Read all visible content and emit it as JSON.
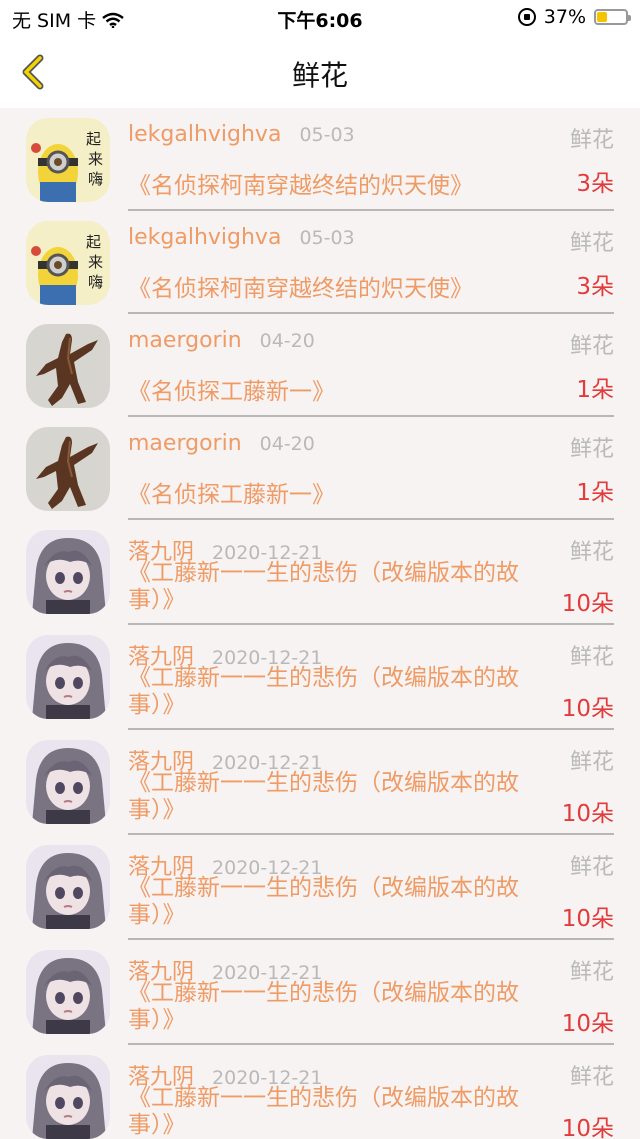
{
  "status_bar": {
    "carrier": "无 SIM 卡",
    "time": "下午6:06",
    "battery": "37%",
    "battery_level": 0.37
  },
  "nav": {
    "title": "鲜花"
  },
  "rows": [
    {
      "user": "lekgalhvighva",
      "date": "05-03",
      "tag": "鲜花",
      "book": "《名侦探柯南穿越终结的炽天使》",
      "count": "3朵",
      "avatar": "minion"
    },
    {
      "user": "lekgalhvighva",
      "date": "05-03",
      "tag": "鲜花",
      "book": "《名侦探柯南穿越终结的炽天使》",
      "count": "3朵",
      "avatar": "minion"
    },
    {
      "user": "maergorin",
      "date": "04-20",
      "tag": "鲜花",
      "book": "《名侦探工藤新一》",
      "count": "1朵",
      "avatar": "sculpture"
    },
    {
      "user": "maergorin",
      "date": "04-20",
      "tag": "鲜花",
      "book": "《名侦探工藤新一》",
      "count": "1朵",
      "avatar": "sculpture"
    },
    {
      "user": "落九阴",
      "date": "2020-12-21",
      "tag": "鲜花",
      "book": "《工藤新一一生的悲伤（改编版本的故事）》",
      "count": "10朵",
      "avatar": "anime-girl"
    },
    {
      "user": "落九阴",
      "date": "2020-12-21",
      "tag": "鲜花",
      "book": "《工藤新一一生的悲伤（改编版本的故事）》",
      "count": "10朵",
      "avatar": "anime-girl"
    },
    {
      "user": "落九阴",
      "date": "2020-12-21",
      "tag": "鲜花",
      "book": "《工藤新一一生的悲伤（改编版本的故事）》",
      "count": "10朵",
      "avatar": "anime-girl"
    },
    {
      "user": "落九阴",
      "date": "2020-12-21",
      "tag": "鲜花",
      "book": "《工藤新一一生的悲伤（改编版本的故事）》",
      "count": "10朵",
      "avatar": "anime-girl"
    },
    {
      "user": "落九阴",
      "date": "2020-12-21",
      "tag": "鲜花",
      "book": "《工藤新一一生的悲伤（改编版本的故事）》",
      "count": "10朵",
      "avatar": "anime-girl"
    },
    {
      "user": "落九阴",
      "date": "2020-12-21",
      "tag": "鲜花",
      "book": "《工藤新一一生的悲伤（改编版本的故事）》",
      "count": "10朵",
      "avatar": "anime-girl"
    }
  ]
}
